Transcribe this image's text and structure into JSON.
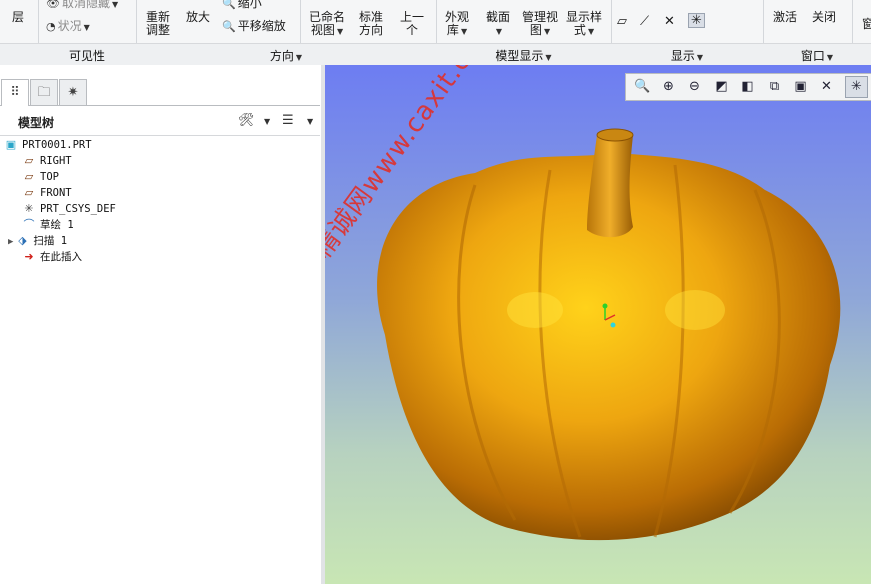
{
  "ribbon": {
    "layer": "层",
    "unhide": "取消隐藏",
    "status": "状况",
    "refit_line1": "重新",
    "refit_line2": "调整",
    "zoom_in": "放大",
    "zoom_out": "缩小",
    "pan_zoom": "平移缩放",
    "saved_views_line1": "已命名",
    "saved_views_line2": "视图",
    "standard_line1": "标准",
    "standard_line2": "方向",
    "previous_line1": "上一",
    "previous_line2": "个",
    "appearance_line1": "外观",
    "appearance_line2": "库",
    "section": "截面",
    "manage_views_line1": "管理视",
    "manage_views_line2": "图",
    "display_style_line1": "显示样",
    "display_style_line2": "式",
    "activate": "激活",
    "close": "关闭",
    "window_partial": "窗"
  },
  "groups": {
    "visibility": "可见性",
    "orientation": "方向",
    "model_display": "模型显示",
    "show": "显示",
    "window": "窗口"
  },
  "panel": {
    "tree_title": "模型树"
  },
  "tree": [
    {
      "label": "PRT0001.PRT",
      "icon": "part-icon"
    },
    {
      "label": "RIGHT",
      "icon": "datum-plane-icon"
    },
    {
      "label": "TOP",
      "icon": "datum-plane-icon"
    },
    {
      "label": "FRONT",
      "icon": "datum-plane-icon"
    },
    {
      "label": "PRT_CSYS_DEF",
      "icon": "csys-icon"
    },
    {
      "label": "草绘 1",
      "icon": "sketch-icon"
    },
    {
      "label": "扫描 1",
      "icon": "sweep-icon"
    },
    {
      "label": "在此插入",
      "icon": "insert-here-icon"
    }
  ],
  "watermark": "Creo精诚网www.caxit.com",
  "colors": {
    "pumpkin": "#e39a0c",
    "insert_arrow": "#d0211b",
    "watermark": "#e0302a"
  }
}
